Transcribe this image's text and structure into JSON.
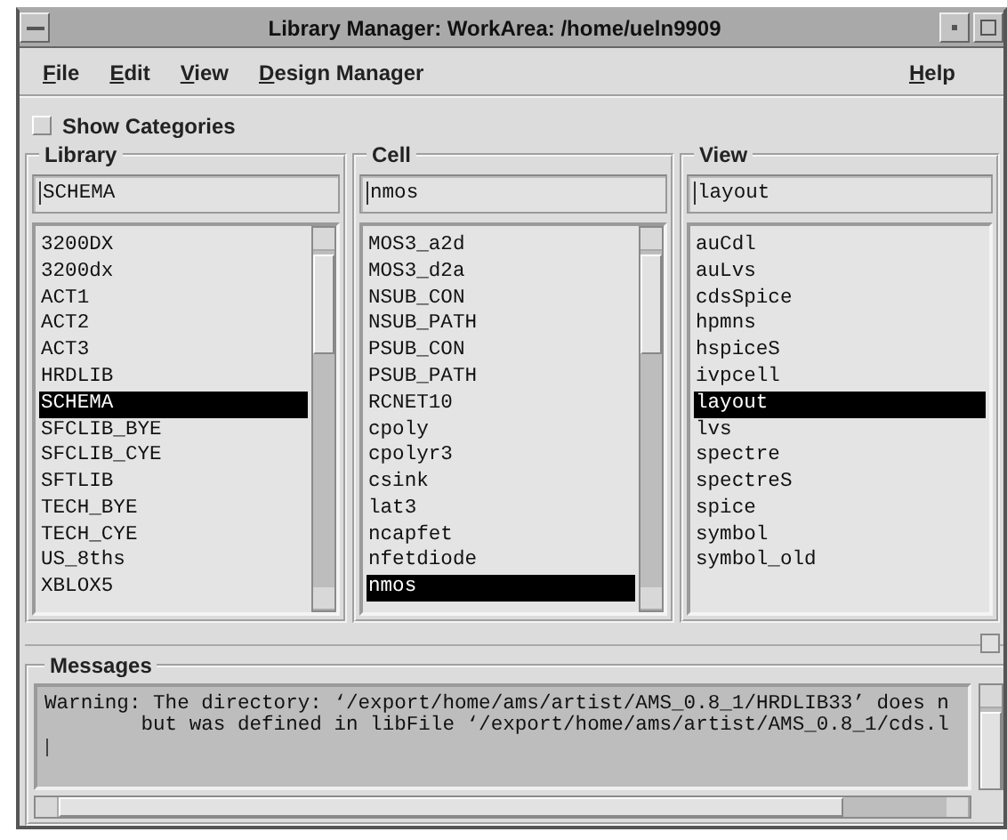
{
  "window": {
    "title": "Library Manager: WorkArea: /home/ueln9909"
  },
  "menu": [
    {
      "label": "File"
    },
    {
      "label": "Edit"
    },
    {
      "label": "View"
    },
    {
      "label": "Design Manager"
    }
  ],
  "help_menu": {
    "label": "Help"
  },
  "show_categories": {
    "label": "Show Categories",
    "checked": false
  },
  "columns": [
    {
      "title": "Library",
      "value": "SCHEMA",
      "scrollbar": true,
      "items": [
        {
          "label": "3200DX",
          "selected": false
        },
        {
          "label": "3200dx",
          "selected": false
        },
        {
          "label": "ACT1",
          "selected": false
        },
        {
          "label": "ACT2",
          "selected": false
        },
        {
          "label": "ACT3",
          "selected": false
        },
        {
          "label": "HRDLIB",
          "selected": false
        },
        {
          "label": "SCHEMA",
          "selected": true
        },
        {
          "label": "SFCLIB_BYE",
          "selected": false
        },
        {
          "label": "SFCLIB_CYE",
          "selected": false
        },
        {
          "label": "SFTLIB",
          "selected": false
        },
        {
          "label": "TECH_BYE",
          "selected": false
        },
        {
          "label": "TECH_CYE",
          "selected": false
        },
        {
          "label": "US_8ths",
          "selected": false
        },
        {
          "label": "XBLOX5",
          "selected": false
        }
      ]
    },
    {
      "title": "Cell",
      "value": "nmos",
      "scrollbar": true,
      "items": [
        {
          "label": "MOS3_a2d",
          "selected": false
        },
        {
          "label": "MOS3_d2a",
          "selected": false
        },
        {
          "label": "NSUB_CON",
          "selected": false
        },
        {
          "label": "NSUB_PATH",
          "selected": false
        },
        {
          "label": "PSUB_CON",
          "selected": false
        },
        {
          "label": "PSUB_PATH",
          "selected": false
        },
        {
          "label": "RCNET10",
          "selected": false
        },
        {
          "label": "cpoly",
          "selected": false
        },
        {
          "label": "cpolyr3",
          "selected": false
        },
        {
          "label": "csink",
          "selected": false
        },
        {
          "label": "lat3",
          "selected": false
        },
        {
          "label": "ncapfet",
          "selected": false
        },
        {
          "label": "nfetdiode",
          "selected": false
        },
        {
          "label": "nmos",
          "selected": true
        }
      ]
    },
    {
      "title": "View",
      "value": "layout",
      "scrollbar": false,
      "items": [
        {
          "label": "auCdl",
          "selected": false
        },
        {
          "label": "auLvs",
          "selected": false
        },
        {
          "label": "cdsSpice",
          "selected": false
        },
        {
          "label": "hpmns",
          "selected": false
        },
        {
          "label": "hspiceS",
          "selected": false
        },
        {
          "label": "ivpcell",
          "selected": false
        },
        {
          "label": "layout",
          "selected": true
        },
        {
          "label": "lvs",
          "selected": false
        },
        {
          "label": "spectre",
          "selected": false
        },
        {
          "label": "spectreS",
          "selected": false
        },
        {
          "label": "spice",
          "selected": false
        },
        {
          "label": "symbol",
          "selected": false
        },
        {
          "label": "symbol_old",
          "selected": false
        }
      ]
    }
  ],
  "messages": {
    "title": "Messages",
    "lines": [
      "Warning: The directory: ‘/export/home/ams/artist/AMS_0.8_1/HRDLIB33’ does n",
      "        but was defined in libFile ‘/export/home/ams/artist/AMS_0.8_1/cds.l"
    ]
  }
}
